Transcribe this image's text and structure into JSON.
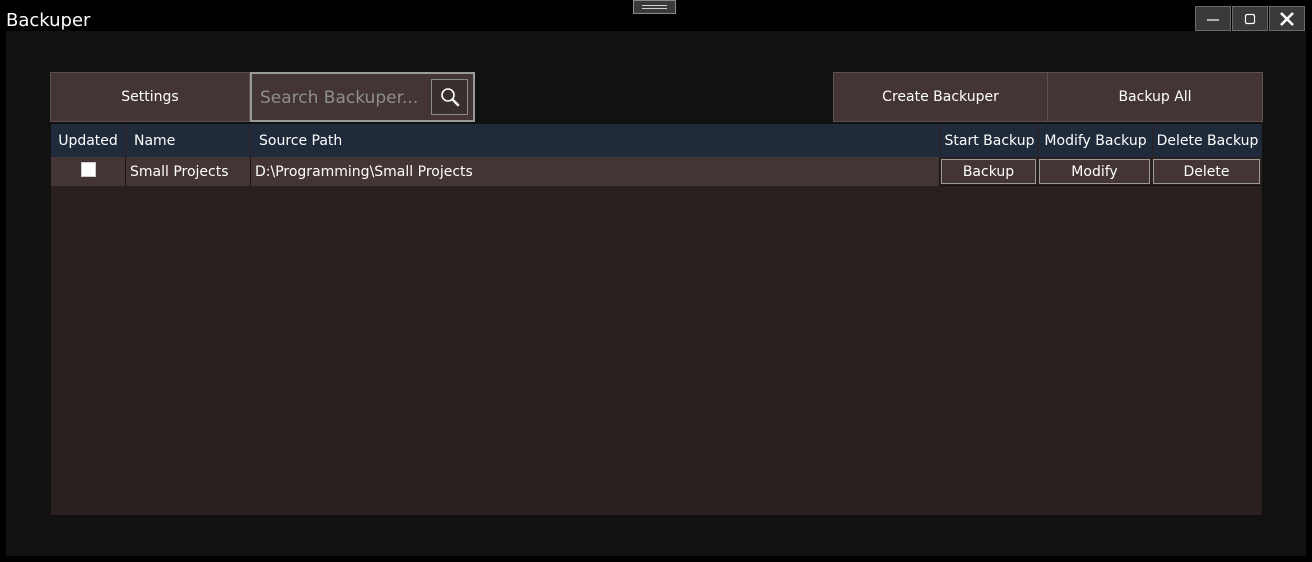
{
  "window": {
    "title": "Backuper",
    "minimize_icon": "minimize-icon",
    "maximize_icon": "maximize-icon",
    "close_icon": "close-icon"
  },
  "toolbar": {
    "settings_label": "Settings",
    "search_placeholder": "Search Backuper...",
    "search_value": "",
    "search_icon": "search-icon",
    "create_label": "Create Backuper",
    "backup_all_label": "Backup All"
  },
  "table": {
    "columns": [
      "Updated",
      "Name",
      "Source Path",
      "Start Backup",
      "Modify Backup",
      "Delete Backup"
    ],
    "rows": [
      {
        "updated": false,
        "name": "Small Projects",
        "source_path": "D:\\Programming\\Small Projects",
        "backup_label": "Backup",
        "modify_label": "Modify",
        "delete_label": "Delete"
      }
    ]
  },
  "colors": {
    "background": "#000000",
    "client": "#111111",
    "button": "#433535",
    "header": "#1f2a3a",
    "grid": "#2a2020"
  }
}
